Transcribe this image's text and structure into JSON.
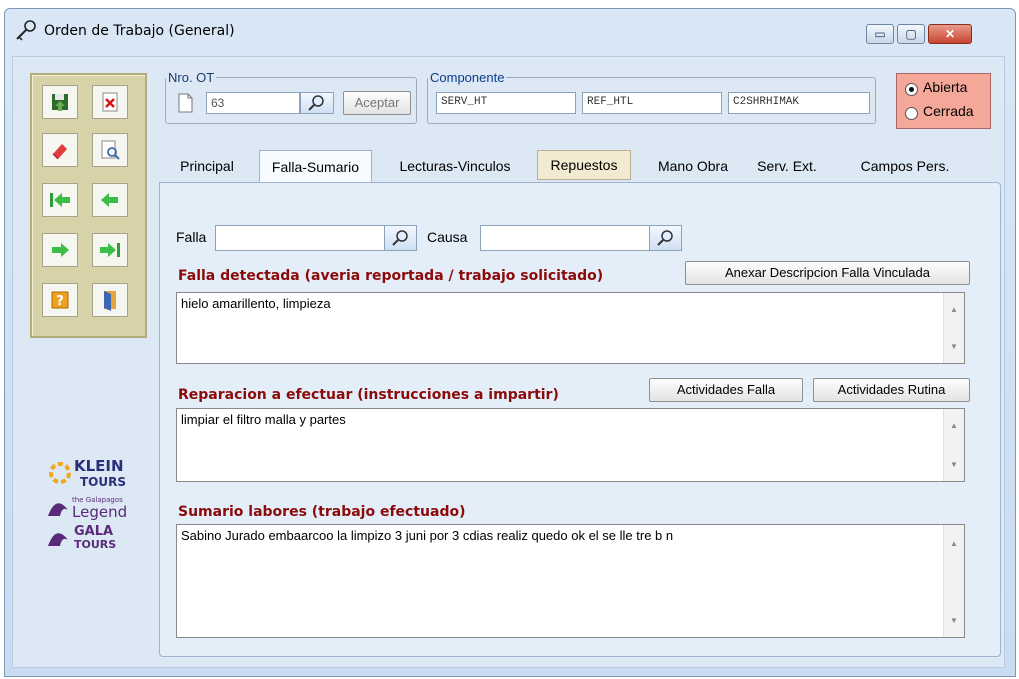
{
  "window": {
    "title": "Orden de Trabajo (General)",
    "controls": {
      "minimize": "▭",
      "maximize": "▢",
      "close": "✕"
    }
  },
  "toolbar": {
    "buttons": [
      {
        "icon": "save-icon"
      },
      {
        "icon": "delete-icon"
      },
      {
        "icon": "eraser-icon"
      },
      {
        "icon": "preview-icon"
      },
      {
        "icon": "first-record-icon"
      },
      {
        "icon": "previous-record-icon"
      },
      {
        "icon": "next-record-icon"
      },
      {
        "icon": "last-record-icon"
      },
      {
        "icon": "help-icon"
      },
      {
        "icon": "exit-icon"
      }
    ]
  },
  "nro_ot": {
    "legend": "Nro. OT",
    "value": "63",
    "accept_label": "Aceptar"
  },
  "componente": {
    "legend": "Componente",
    "fields": [
      "SERV_HT",
      "REF_HTL",
      "C2SHRHIMAK"
    ]
  },
  "status": {
    "options": [
      "Abierta",
      "Cerrada"
    ],
    "selected": "Abierta"
  },
  "tabs": [
    "Principal",
    "Falla-Sumario",
    "Lecturas-Vinculos",
    "Repuestos",
    "Mano Obra",
    "Serv. Ext.",
    "Campos Pers."
  ],
  "active_tab": "Falla-Sumario",
  "falla": {
    "label": "Falla",
    "value": ""
  },
  "causa": {
    "label": "Causa",
    "value": ""
  },
  "falla_detectada": {
    "title": "Falla detectada (averia reportada / trabajo solicitado)",
    "button": "Anexar Descripcion Falla Vinculada",
    "text": "hielo amarillento, limpieza"
  },
  "reparacion": {
    "title": "Reparacion a efectuar (instrucciones a impartir)",
    "buttons": [
      "Actividades Falla",
      "Actividades Rutina"
    ],
    "text": "limpiar el filtro malla y partes"
  },
  "sumario": {
    "title": "Sumario labores (trabajo efectuado)",
    "text": "Sabino Jurado embaarcoo la limpizo  3 juni por 3 cdias realiz  quedo ok el  se lle  tre b n"
  },
  "logos": {
    "klein": [
      "KLEIN",
      "TOURS"
    ],
    "legend": [
      "the Galapagos",
      "Legend"
    ],
    "gala": [
      "GALA",
      "TOURS"
    ]
  },
  "colors": {
    "accent_red": "#8b0a0a",
    "status_bg": "#f5a79a",
    "toolbar_bg": "#d8d2a8"
  }
}
